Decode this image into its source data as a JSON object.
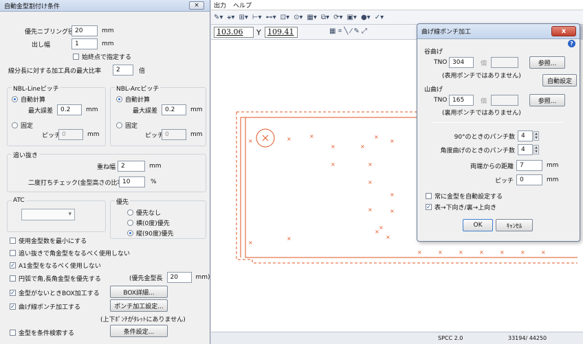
{
  "left_dialog": {
    "title": "自動金型割付け条件",
    "close_label": "×",
    "nibbling_dia_label": "優先ニブリング径",
    "nibbling_dia_value": "20",
    "nibbling_dia_unit": "mm",
    "width_label": "出し幅",
    "width_value": "1",
    "width_unit": "mm",
    "start_point_label": "始終点で指定する",
    "ratio_label": "線分長に対する加工具の最大比率",
    "ratio_value": "2",
    "ratio_unit": "倍",
    "nbl_line": {
      "title": "NBL-Lineピッチ",
      "auto_label": "自動計算",
      "max_err_label": "最大誤差",
      "max_err_value": "0.2",
      "unit": "mm",
      "fixed_label": "固定",
      "pitch_label": "ピッチ",
      "pitch_value": "0"
    },
    "nbl_arc": {
      "title": "NBL-Arcピッチ",
      "auto_label": "自動計算",
      "max_err_label": "最大誤差",
      "max_err_value": "0.2",
      "unit": "mm",
      "fixed_label": "固定",
      "pitch_label": "ピッチ",
      "pitch_value": "0"
    },
    "okuri": {
      "title": "追い抜き",
      "overlap_label": "重ね幅",
      "overlap_value": "2",
      "overlap_unit": "mm",
      "check_label": "二度打ちチェック(金型高さの比率)",
      "check_value": "10",
      "check_unit": "%"
    },
    "atc_label": "ATC",
    "priority": {
      "title": "優先",
      "none_label": "優先なし",
      "horizontal_label": "横(0度)優先",
      "vertical_label": "縦(90度)優先"
    },
    "opt_min_tools": "使用金型数を最小にする",
    "opt_okuri_corner": "追い抜きで角金型をなるべく使用しない",
    "opt_a1": "A1金型をなるべく使用しない",
    "opt_round_long": "円弧で角,長角金型を優先する",
    "priority_len_label": "(優先金型長",
    "priority_len_value": "20",
    "priority_len_unit": "mm)",
    "opt_box": "金型がないときBOX加工する",
    "box_btn": "BOX詳細...",
    "opt_bend": "曲げ線ポンチ加工する",
    "punch_btn": "ポンチ加工設定...",
    "punch_note": "(上下ﾎﾟﾝﾁがﾀﾚｯﾄにありません)",
    "opt_search": "金型を条件検索する",
    "cond_btn": "条件設定..."
  },
  "menu": {
    "items": [
      "出力",
      "ヘルプ"
    ]
  },
  "coords": {
    "x_value": "103.06",
    "y_label": "Y",
    "y_value": "109.41"
  },
  "status": {
    "material": "SPCC 2.0",
    "counter": "33194/ 44250"
  },
  "right_dialog": {
    "title": "曲げ線ポンチ加工",
    "close_label": "x",
    "valley_title": "谷曲げ",
    "valley_tno_label": "TNO",
    "valley_tno_value": "304",
    "valley_unit": "個",
    "valley_browse": "参照...",
    "valley_note": "(表用ポンチではありません)",
    "auto_set_btn": "自動設定",
    "mountain_title": "山曲げ",
    "mountain_tno_label": "TNO",
    "mountain_tno_value": "165",
    "mountain_unit": "個",
    "mountain_browse": "参照...",
    "mountain_note": "(裏用ポンチではありません)",
    "punch90_label": "90°のときのパンチ数",
    "punch90_value": "4",
    "punchangle_label": "角度曲げのときのパンチ数",
    "punchangle_value": "4",
    "edge_dist_label": "両端からの距離",
    "edge_dist_value": "7",
    "edge_dist_unit": "mm",
    "pitch_label": "ピッチ",
    "pitch_value": "0",
    "pitch_unit": "mm",
    "always_auto_label": "常に金型を自動設定する",
    "front_back_label": "表→下向き/裏→上向き",
    "ok_label": "OK",
    "cancel_label": "ｷｬﾝｾﾙ"
  },
  "colors": {
    "drawing": "#e0531f",
    "accent": "#2a6fd1"
  }
}
